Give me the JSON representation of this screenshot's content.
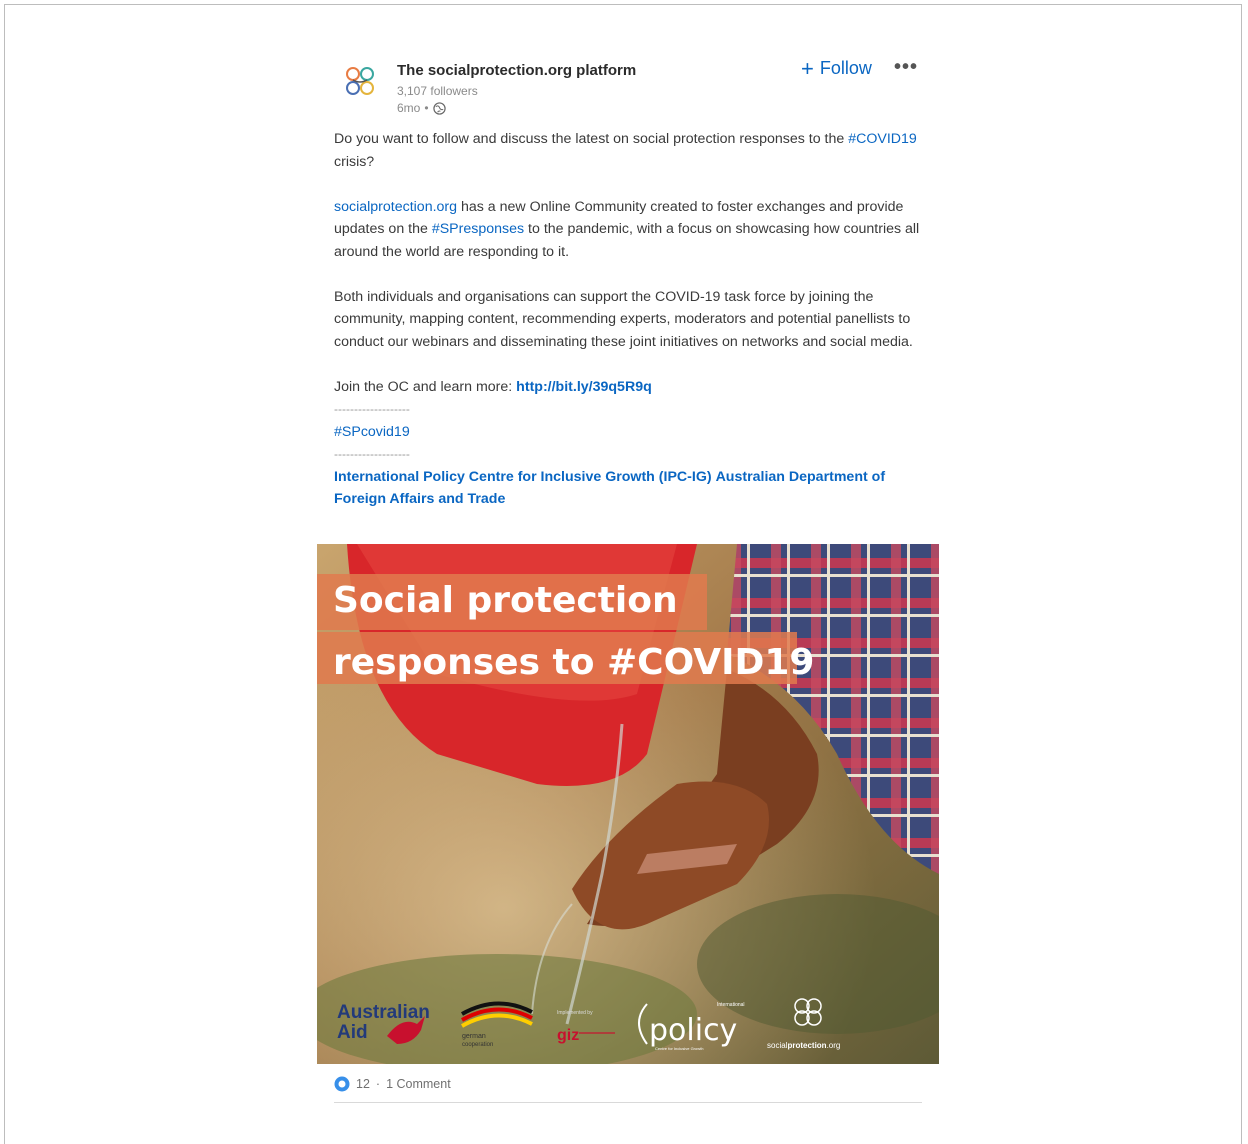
{
  "post": {
    "company_name": "The socialprotection.org platform",
    "followers": "3,107 followers",
    "time": "6mo",
    "separator": "•",
    "follow_label": "+ Follow",
    "follow_plus": "+",
    "follow_text": "Follow",
    "more_label": "•••",
    "paragraphs": {
      "p1_text": "Do you want to follow and discuss the latest on social protection responses to the ",
      "p1_hashtag": "#COVID19",
      "p1_tail": " crisis?",
      "p2_link": "socialprotection.org",
      "p2_text_a": " has a new Online Community created to foster exchanges and provide updates on the ",
      "p2_hashtag": "#SPresponses",
      "p2_text_b": " to the pandemic, with a focus on showcasing how countries all around the world are responding to it.",
      "p3_text": "Both individuals and organisations can support the COVID-19 task force by joining the community, mapping content, recommending experts, moderators and potential panellists to conduct our webinars and disseminating these joint initiatives on networks and social media.",
      "p4_text": "Join the OC and learn more: ",
      "p4_link": "http://bit.ly/39q5R9q",
      "dashes": "-------------------",
      "hashtag_covid": "#SPcovid19",
      "mention_ipc": "International Policy Centre for Inclusive Growth (IPC-IG)",
      "mention_dfat": "Australian Department of Foreign Affairs and Trade"
    },
    "image": {
      "title_line1": "Social protection",
      "title_line2": "responses to #COVID19",
      "logo_aus_line1": "Australian",
      "logo_aus_line2": "Aid",
      "logo_german_line1": "german",
      "logo_german_line2": "cooperation",
      "logo_giz_pre": "Implemented by",
      "logo_giz": "giz",
      "logo_policy": "policy",
      "logo_policy_sup": "International",
      "logo_policy_sub": "Centre for Inclusive Growth",
      "logo_sp_a": "social",
      "logo_sp_b": "protection",
      "logo_sp_c": ".org"
    },
    "reactions_count": "12",
    "comments_count": "1 Comment",
    "reactions_sep": "·"
  },
  "colors": {
    "link": "#0a66c2",
    "text": "#3a3a3a",
    "meta": "#8a8a8a",
    "hero_banner": "#e07a4e"
  }
}
